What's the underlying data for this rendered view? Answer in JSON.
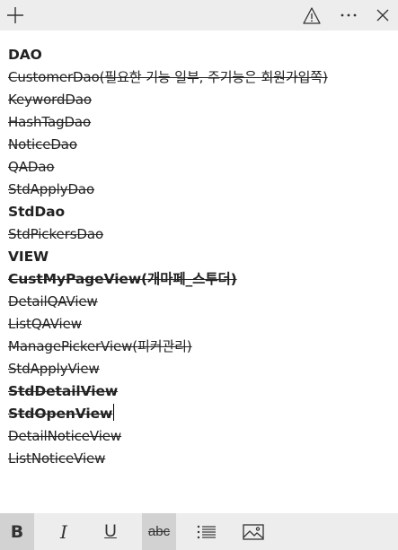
{
  "toolbar": {
    "icons": [
      "plus-icon",
      "warning-icon",
      "more-icon"
    ]
  },
  "note": {
    "lines": [
      {
        "text": "DAO",
        "bold": true,
        "strike": false
      },
      {
        "text": "CustomerDao(필요한 기능 일부, 주기능은 회원가입쪽)",
        "bold": false,
        "strike": true
      },
      {
        "text": "KeywordDao",
        "bold": false,
        "strike": true
      },
      {
        "text": "HashTagDao",
        "bold": false,
        "strike": true
      },
      {
        "text": "NoticeDao",
        "bold": false,
        "strike": true
      },
      {
        "text": "QADao",
        "bold": false,
        "strike": true
      },
      {
        "text": "StdApplyDao",
        "bold": false,
        "strike": true
      },
      {
        "text": "StdDao",
        "bold": true,
        "strike": false
      },
      {
        "text": "StdPickersDao",
        "bold": false,
        "strike": true
      },
      {
        "text": "VIEW",
        "bold": true,
        "strike": false
      },
      {
        "text": "CustMyPageView(개마페_스투더)",
        "bold": true,
        "strike": true
      },
      {
        "text": "DetailQAView",
        "bold": false,
        "strike": true
      },
      {
        "text": "ListQAView",
        "bold": false,
        "strike": true
      },
      {
        "text": "ManagePickerView(피커관리)",
        "bold": false,
        "strike": true
      },
      {
        "text": "StdApplyView",
        "bold": false,
        "strike": true
      },
      {
        "text": "StdDetailView",
        "bold": true,
        "strike": true
      },
      {
        "text": "StdOpenView",
        "bold": true,
        "strike": true,
        "caret": true
      },
      {
        "text": "DetailNoticeView",
        "bold": false,
        "strike": true
      },
      {
        "text": "ListNoticeView",
        "bold": false,
        "strike": true
      }
    ]
  },
  "format_bar": {
    "bold_label": "B",
    "italic_label": "I",
    "underline_label": "U",
    "strike_label": "abc",
    "active": [
      "bold",
      "strikethrough"
    ]
  }
}
